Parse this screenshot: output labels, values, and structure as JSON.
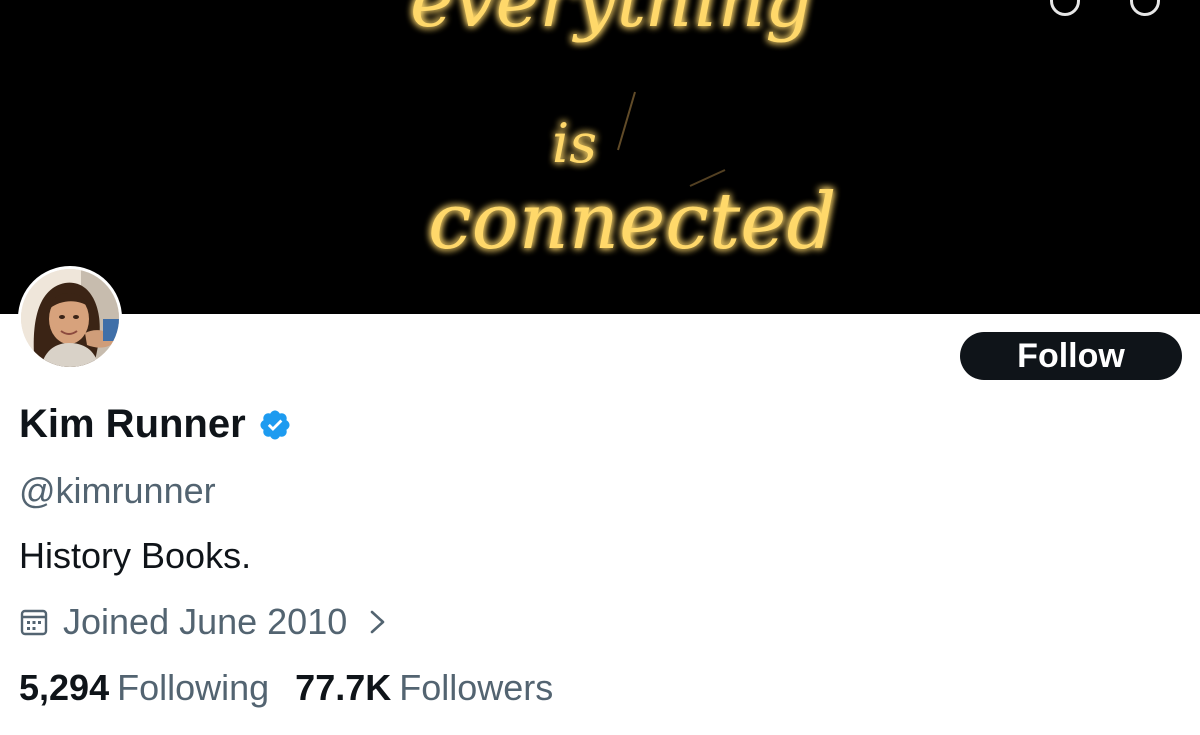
{
  "banner": {
    "neon_line1": "everything",
    "neon_line2": "is",
    "neon_line3": "connected"
  },
  "profile": {
    "display_name": "Kim Runner",
    "handle": "@kimrunner",
    "bio": "History Books.",
    "joined": "Joined June 2010",
    "follow_label": "Follow",
    "verified": true
  },
  "stats": {
    "following_count": "5,294",
    "following_label": "Following",
    "followers_count": "77.7K",
    "followers_label": "Followers"
  },
  "colors": {
    "primary_text": "#0f1419",
    "secondary_text": "#536471",
    "verified_blue": "#1d9bf0",
    "neon": "#ffd86b"
  }
}
